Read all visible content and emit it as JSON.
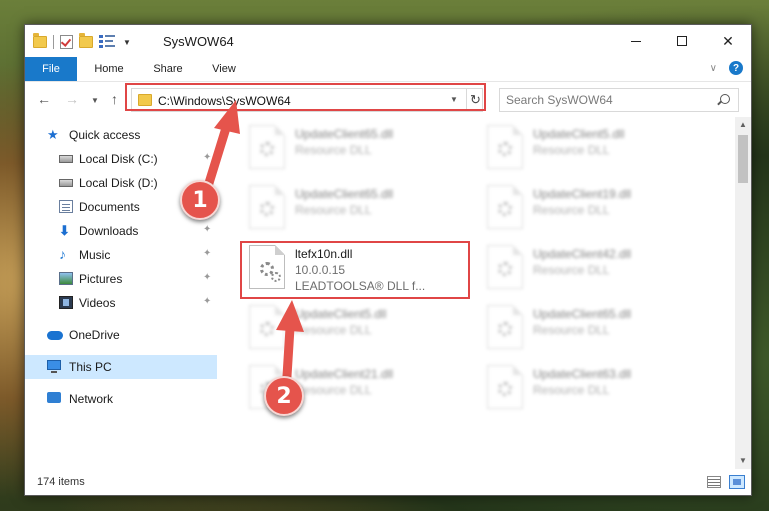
{
  "window": {
    "title": "SysWOW64"
  },
  "caption": {
    "minimize": "—",
    "maximize": "☐",
    "close": "✕"
  },
  "ribbon": {
    "tabs": [
      "File",
      "Home",
      "Share",
      "View"
    ]
  },
  "address": {
    "path": "C:\\Windows\\SysWOW64",
    "refresh_icon": "refresh-icon"
  },
  "search": {
    "placeholder": "Search SysWOW64"
  },
  "sidebar": {
    "items": [
      {
        "label": "Quick access",
        "icon": "star-icon"
      },
      {
        "label": "Local Disk (C:)",
        "icon": "disk-icon"
      },
      {
        "label": "Local Disk (D:)",
        "icon": "disk-icon"
      },
      {
        "label": "Documents",
        "icon": "documents-icon"
      },
      {
        "label": "Downloads",
        "icon": "download-icon"
      },
      {
        "label": "Music",
        "icon": "music-icon"
      },
      {
        "label": "Pictures",
        "icon": "pictures-icon"
      },
      {
        "label": "Videos",
        "icon": "videos-icon"
      },
      {
        "label": "OneDrive",
        "icon": "cloud-icon"
      },
      {
        "label": "This PC",
        "icon": "pc-icon"
      },
      {
        "label": "Network",
        "icon": "network-icon"
      }
    ],
    "selected": "This PC"
  },
  "files": [
    {
      "name": "UpdateClient65.dll",
      "type": "Resource DLL"
    },
    {
      "name": "UpdateClient5.dll",
      "type": "Resource DLL"
    },
    {
      "name": "UpdateClient65.dll",
      "type": "Resource DLL"
    },
    {
      "name": "UpdateClient19.dll",
      "type": "Resource DLL"
    },
    {
      "name": "ltefx10n.dll",
      "version": "10.0.0.15",
      "description": "LEADTOOLSA® DLL f..."
    },
    {
      "name": "UpdateClient42.dll",
      "type": "Resource DLL"
    },
    {
      "name": "UpdateClient5.dll",
      "type": "Resource DLL"
    },
    {
      "name": "UpdateClient65.dll",
      "type": "Resource DLL"
    },
    {
      "name": "UpdateClient21.dll",
      "type": "Resource DLL"
    },
    {
      "name": "UpdateClient63.dll",
      "type": "Resource DLL"
    }
  ],
  "status": {
    "item_count": "174 items"
  },
  "callouts": [
    "1",
    "2"
  ],
  "colors": {
    "accent": "#1979ca",
    "highlight": "#e04646",
    "selected_bg": "#cde8ff",
    "badge": "#e5544c"
  }
}
